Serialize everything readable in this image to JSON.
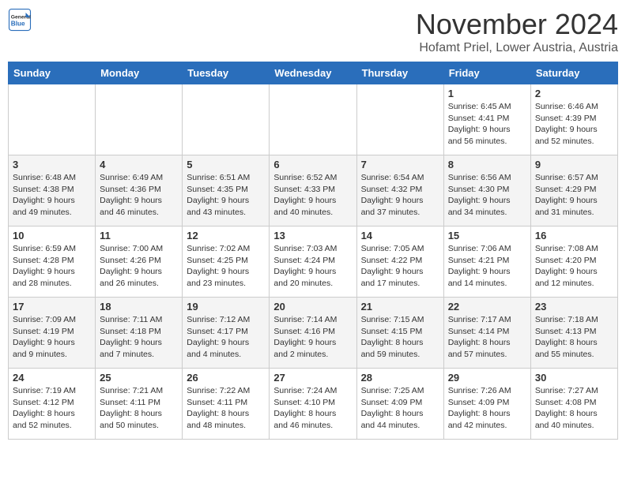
{
  "header": {
    "logo_general": "General",
    "logo_blue": "Blue",
    "month_title": "November 2024",
    "location": "Hofamt Priel, Lower Austria, Austria"
  },
  "weekdays": [
    "Sunday",
    "Monday",
    "Tuesday",
    "Wednesday",
    "Thursday",
    "Friday",
    "Saturday"
  ],
  "weeks": [
    {
      "days": [
        {
          "date": "",
          "info": ""
        },
        {
          "date": "",
          "info": ""
        },
        {
          "date": "",
          "info": ""
        },
        {
          "date": "",
          "info": ""
        },
        {
          "date": "",
          "info": ""
        },
        {
          "date": "1",
          "info": "Sunrise: 6:45 AM\nSunset: 4:41 PM\nDaylight: 9 hours\nand 56 minutes."
        },
        {
          "date": "2",
          "info": "Sunrise: 6:46 AM\nSunset: 4:39 PM\nDaylight: 9 hours\nand 52 minutes."
        }
      ]
    },
    {
      "days": [
        {
          "date": "3",
          "info": "Sunrise: 6:48 AM\nSunset: 4:38 PM\nDaylight: 9 hours\nand 49 minutes."
        },
        {
          "date": "4",
          "info": "Sunrise: 6:49 AM\nSunset: 4:36 PM\nDaylight: 9 hours\nand 46 minutes."
        },
        {
          "date": "5",
          "info": "Sunrise: 6:51 AM\nSunset: 4:35 PM\nDaylight: 9 hours\nand 43 minutes."
        },
        {
          "date": "6",
          "info": "Sunrise: 6:52 AM\nSunset: 4:33 PM\nDaylight: 9 hours\nand 40 minutes."
        },
        {
          "date": "7",
          "info": "Sunrise: 6:54 AM\nSunset: 4:32 PM\nDaylight: 9 hours\nand 37 minutes."
        },
        {
          "date": "8",
          "info": "Sunrise: 6:56 AM\nSunset: 4:30 PM\nDaylight: 9 hours\nand 34 minutes."
        },
        {
          "date": "9",
          "info": "Sunrise: 6:57 AM\nSunset: 4:29 PM\nDaylight: 9 hours\nand 31 minutes."
        }
      ]
    },
    {
      "days": [
        {
          "date": "10",
          "info": "Sunrise: 6:59 AM\nSunset: 4:28 PM\nDaylight: 9 hours\nand 28 minutes."
        },
        {
          "date": "11",
          "info": "Sunrise: 7:00 AM\nSunset: 4:26 PM\nDaylight: 9 hours\nand 26 minutes."
        },
        {
          "date": "12",
          "info": "Sunrise: 7:02 AM\nSunset: 4:25 PM\nDaylight: 9 hours\nand 23 minutes."
        },
        {
          "date": "13",
          "info": "Sunrise: 7:03 AM\nSunset: 4:24 PM\nDaylight: 9 hours\nand 20 minutes."
        },
        {
          "date": "14",
          "info": "Sunrise: 7:05 AM\nSunset: 4:22 PM\nDaylight: 9 hours\nand 17 minutes."
        },
        {
          "date": "15",
          "info": "Sunrise: 7:06 AM\nSunset: 4:21 PM\nDaylight: 9 hours\nand 14 minutes."
        },
        {
          "date": "16",
          "info": "Sunrise: 7:08 AM\nSunset: 4:20 PM\nDaylight: 9 hours\nand 12 minutes."
        }
      ]
    },
    {
      "days": [
        {
          "date": "17",
          "info": "Sunrise: 7:09 AM\nSunset: 4:19 PM\nDaylight: 9 hours\nand 9 minutes."
        },
        {
          "date": "18",
          "info": "Sunrise: 7:11 AM\nSunset: 4:18 PM\nDaylight: 9 hours\nand 7 minutes."
        },
        {
          "date": "19",
          "info": "Sunrise: 7:12 AM\nSunset: 4:17 PM\nDaylight: 9 hours\nand 4 minutes."
        },
        {
          "date": "20",
          "info": "Sunrise: 7:14 AM\nSunset: 4:16 PM\nDaylight: 9 hours\nand 2 minutes."
        },
        {
          "date": "21",
          "info": "Sunrise: 7:15 AM\nSunset: 4:15 PM\nDaylight: 8 hours\nand 59 minutes."
        },
        {
          "date": "22",
          "info": "Sunrise: 7:17 AM\nSunset: 4:14 PM\nDaylight: 8 hours\nand 57 minutes."
        },
        {
          "date": "23",
          "info": "Sunrise: 7:18 AM\nSunset: 4:13 PM\nDaylight: 8 hours\nand 55 minutes."
        }
      ]
    },
    {
      "days": [
        {
          "date": "24",
          "info": "Sunrise: 7:19 AM\nSunset: 4:12 PM\nDaylight: 8 hours\nand 52 minutes."
        },
        {
          "date": "25",
          "info": "Sunrise: 7:21 AM\nSunset: 4:11 PM\nDaylight: 8 hours\nand 50 minutes."
        },
        {
          "date": "26",
          "info": "Sunrise: 7:22 AM\nSunset: 4:11 PM\nDaylight: 8 hours\nand 48 minutes."
        },
        {
          "date": "27",
          "info": "Sunrise: 7:24 AM\nSunset: 4:10 PM\nDaylight: 8 hours\nand 46 minutes."
        },
        {
          "date": "28",
          "info": "Sunrise: 7:25 AM\nSunset: 4:09 PM\nDaylight: 8 hours\nand 44 minutes."
        },
        {
          "date": "29",
          "info": "Sunrise: 7:26 AM\nSunset: 4:09 PM\nDaylight: 8 hours\nand 42 minutes."
        },
        {
          "date": "30",
          "info": "Sunrise: 7:27 AM\nSunset: 4:08 PM\nDaylight: 8 hours\nand 40 minutes."
        }
      ]
    }
  ]
}
